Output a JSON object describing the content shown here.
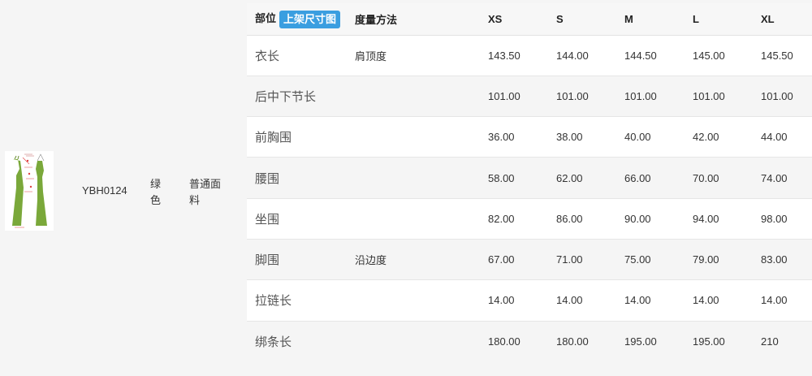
{
  "product": {
    "style_no": "YBH0124",
    "color": "绿色",
    "fabric": "普通面料",
    "thumbnail_icon": "dress-image-icon",
    "dress_color": "#7aa83a"
  },
  "table": {
    "headers": {
      "part": "部位",
      "action_button": "上架尺寸图",
      "method": "度量方法",
      "sizes": [
        "XS",
        "S",
        "M",
        "L",
        "XL"
      ]
    },
    "rows": [
      {
        "part": "衣长",
        "method": "肩顶度",
        "values": [
          "143.50",
          "144.00",
          "144.50",
          "145.00",
          "145.50"
        ]
      },
      {
        "part": "后中下节长",
        "method": "",
        "values": [
          "101.00",
          "101.00",
          "101.00",
          "101.00",
          "101.00"
        ]
      },
      {
        "part": "前胸围",
        "method": "",
        "values": [
          "36.00",
          "38.00",
          "40.00",
          "42.00",
          "44.00"
        ]
      },
      {
        "part": "腰围",
        "method": "",
        "values": [
          "58.00",
          "62.00",
          "66.00",
          "70.00",
          "74.00"
        ]
      },
      {
        "part": "坐围",
        "method": "",
        "values": [
          "82.00",
          "86.00",
          "90.00",
          "94.00",
          "98.00"
        ]
      },
      {
        "part": "脚围",
        "method": "沿边度",
        "values": [
          "67.00",
          "71.00",
          "75.00",
          "79.00",
          "83.00"
        ]
      },
      {
        "part": "拉链长",
        "method": "",
        "values": [
          "14.00",
          "14.00",
          "14.00",
          "14.00",
          "14.00"
        ]
      },
      {
        "part": "绑条长",
        "method": "",
        "values": [
          "180.00",
          "180.00",
          "195.00",
          "195.00",
          "210"
        ]
      }
    ]
  },
  "colors": {
    "accent": "#3a9ee0"
  }
}
